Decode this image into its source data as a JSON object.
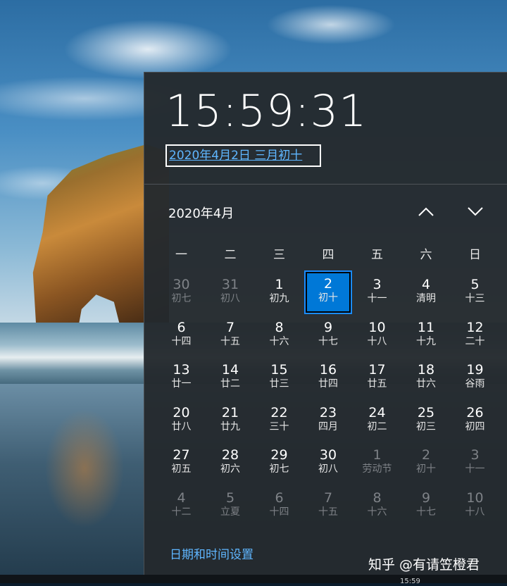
{
  "clock": {
    "time": "15:59:31"
  },
  "date_link": "2020年4月2日 三月初十",
  "calendar": {
    "month_label": "2020年4月",
    "nav": {
      "up_icon": "chevron-up-icon",
      "down_icon": "chevron-down-icon"
    },
    "weekdays": [
      "一",
      "二",
      "三",
      "四",
      "五",
      "六",
      "日"
    ],
    "weeks": [
      [
        {
          "d": "30",
          "l": "初七",
          "dim": true
        },
        {
          "d": "31",
          "l": "初八",
          "dim": true
        },
        {
          "d": "1",
          "l": "初九"
        },
        {
          "d": "2",
          "l": "初十",
          "today": true
        },
        {
          "d": "3",
          "l": "十一"
        },
        {
          "d": "4",
          "l": "清明"
        },
        {
          "d": "5",
          "l": "十三"
        }
      ],
      [
        {
          "d": "6",
          "l": "十四"
        },
        {
          "d": "7",
          "l": "十五"
        },
        {
          "d": "8",
          "l": "十六"
        },
        {
          "d": "9",
          "l": "十七"
        },
        {
          "d": "10",
          "l": "十八"
        },
        {
          "d": "11",
          "l": "十九"
        },
        {
          "d": "12",
          "l": "二十"
        }
      ],
      [
        {
          "d": "13",
          "l": "廿一"
        },
        {
          "d": "14",
          "l": "廿二"
        },
        {
          "d": "15",
          "l": "廿三"
        },
        {
          "d": "16",
          "l": "廿四"
        },
        {
          "d": "17",
          "l": "廿五"
        },
        {
          "d": "18",
          "l": "廿六"
        },
        {
          "d": "19",
          "l": "谷雨"
        }
      ],
      [
        {
          "d": "20",
          "l": "廿八"
        },
        {
          "d": "21",
          "l": "廿九"
        },
        {
          "d": "22",
          "l": "三十"
        },
        {
          "d": "23",
          "l": "四月"
        },
        {
          "d": "24",
          "l": "初二"
        },
        {
          "d": "25",
          "l": "初三"
        },
        {
          "d": "26",
          "l": "初四"
        }
      ],
      [
        {
          "d": "27",
          "l": "初五"
        },
        {
          "d": "28",
          "l": "初六"
        },
        {
          "d": "29",
          "l": "初七"
        },
        {
          "d": "30",
          "l": "初八"
        },
        {
          "d": "1",
          "l": "劳动节",
          "dim": true
        },
        {
          "d": "2",
          "l": "初十",
          "dim": true
        },
        {
          "d": "3",
          "l": "十一",
          "dim": true
        }
      ],
      [
        {
          "d": "4",
          "l": "十二",
          "dim": true
        },
        {
          "d": "5",
          "l": "立夏",
          "dim": true
        },
        {
          "d": "6",
          "l": "十四",
          "dim": true
        },
        {
          "d": "7",
          "l": "十五",
          "dim": true
        },
        {
          "d": "8",
          "l": "十六",
          "dim": true
        },
        {
          "d": "9",
          "l": "十七",
          "dim": true
        },
        {
          "d": "10",
          "l": "十八",
          "dim": true
        }
      ]
    ]
  },
  "settings_link": "日期和时间设置",
  "watermark": "知乎 @有请笠橙君",
  "taskbar": {
    "time": "15:59"
  },
  "colors": {
    "accent": "#0078d7",
    "link": "#5fb6ff",
    "flyout_bg": "#24292e"
  }
}
